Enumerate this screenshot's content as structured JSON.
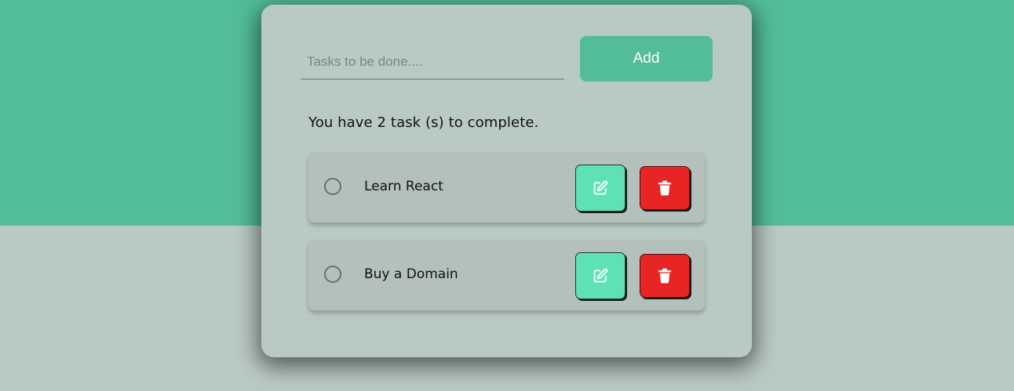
{
  "form": {
    "placeholder": "Tasks to be done....",
    "value": "",
    "add_label": "Add"
  },
  "summary": {
    "text": "You have 2 task (s) to complete."
  },
  "tasks": [
    {
      "label": "Learn React",
      "completed": false
    },
    {
      "label": "Buy a Domain",
      "completed": false
    }
  ],
  "icons": {
    "edit": "edit-icon",
    "delete": "trash-icon"
  },
  "colors": {
    "accent": "#53bd97",
    "background": "#b9c9c3",
    "edit": "#5fe1b8",
    "delete": "#e82525"
  }
}
